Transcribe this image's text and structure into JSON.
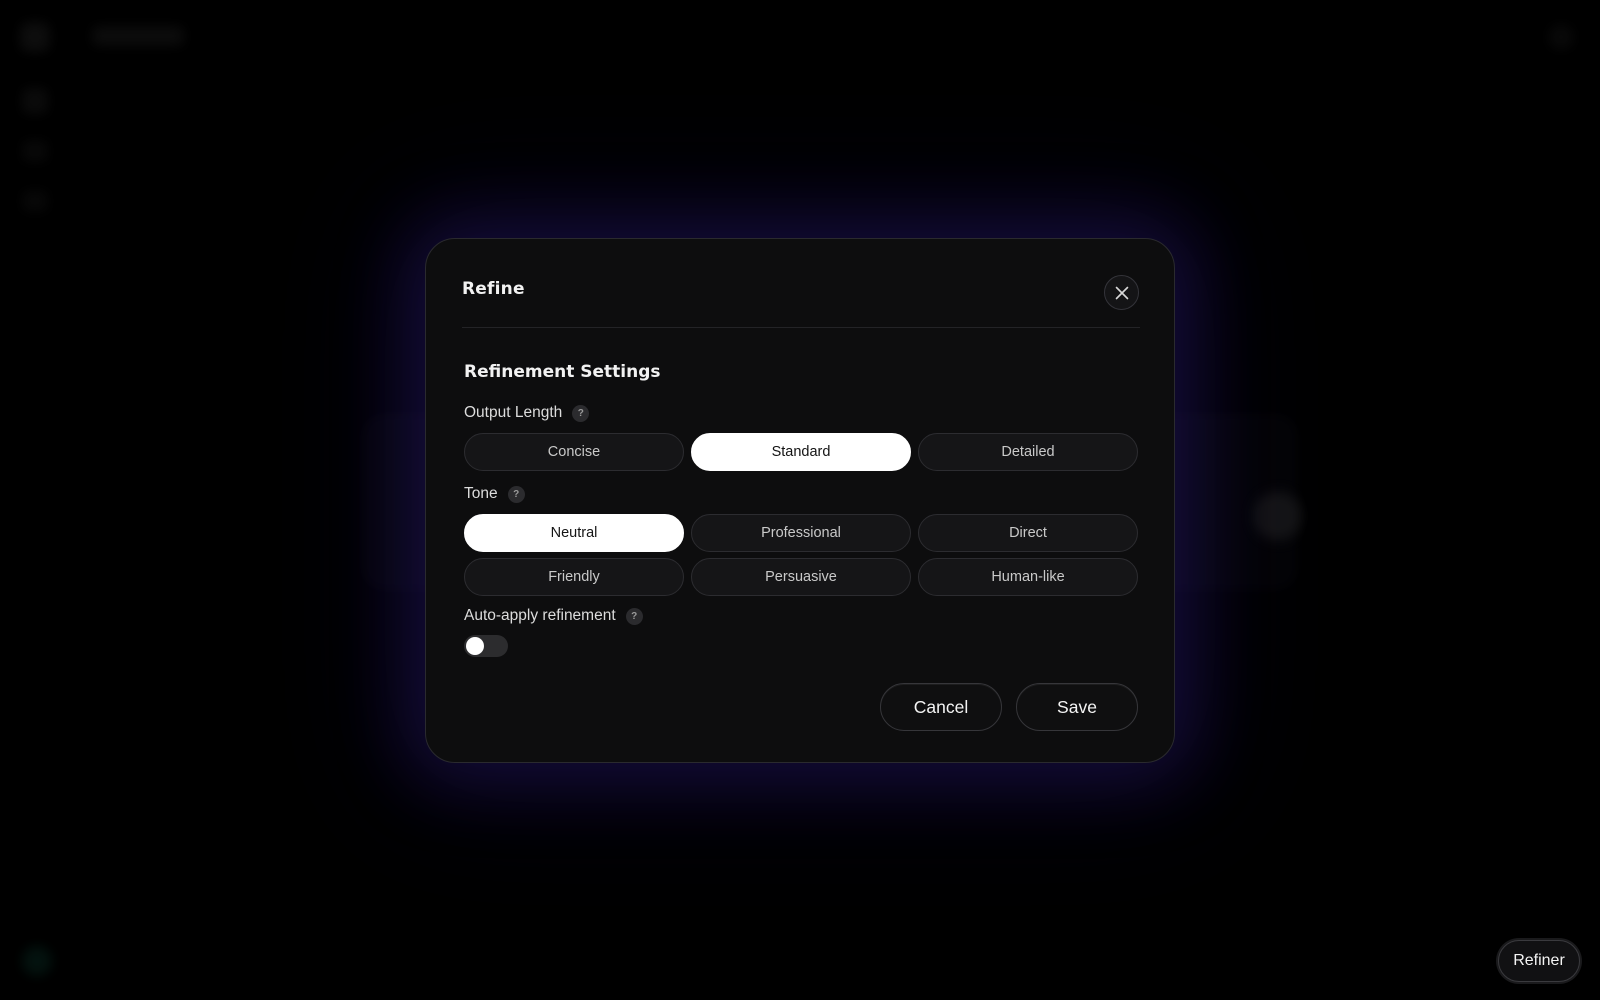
{
  "dialog": {
    "title": "Refine",
    "section_title": "Refinement Settings",
    "output_length": {
      "label": "Output Length",
      "options": [
        "Concise",
        "Standard",
        "Detailed"
      ],
      "selected": "Standard"
    },
    "tone": {
      "label": "Tone",
      "options": [
        "Neutral",
        "Professional",
        "Direct",
        "Friendly",
        "Persuasive",
        "Human-like"
      ],
      "selected": "Neutral"
    },
    "auto_apply": {
      "label": "Auto-apply refinement",
      "enabled": false
    },
    "help_glyph": "?",
    "cancel_label": "Cancel",
    "save_label": "Save"
  },
  "floating": {
    "refiner_label": "Refiner"
  },
  "icons": {
    "close": "close-icon",
    "help": "help-icon"
  },
  "colors": {
    "selected_bg": "#ffffff",
    "option_bg": "#151517",
    "dialog_bg": "#0d0d0e",
    "glow": "#281a6e"
  }
}
